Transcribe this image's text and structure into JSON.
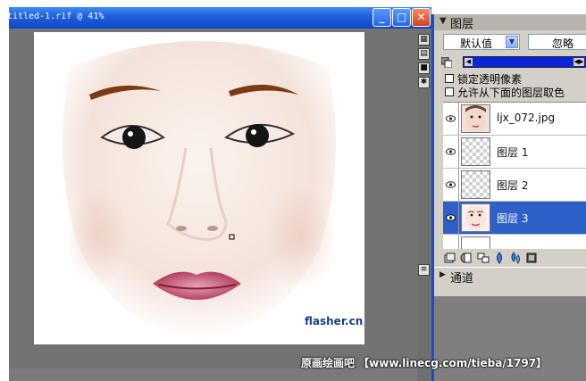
{
  "document": {
    "title": "titled-1.rif @ 41%",
    "buttons": {
      "minimize": "_",
      "maximize": "□",
      "close": "✕"
    },
    "canvas_signature": "flasher.cn"
  },
  "layers_panel": {
    "title": "图层",
    "blend_mode": "默认值",
    "opacity_label": "忽略",
    "checkboxes": [
      {
        "label": "锁定透明像素",
        "checked": false
      },
      {
        "label": "允许从下面的图层取色",
        "checked": false
      }
    ],
    "layers": [
      {
        "name": "ljx_072.jpg",
        "visible": true,
        "selected": false,
        "thumb": "face"
      },
      {
        "name": "图层 1",
        "visible": true,
        "selected": false,
        "thumb": "transparent"
      },
      {
        "name": "图层 2",
        "visible": true,
        "selected": false,
        "thumb": "transparent"
      },
      {
        "name": "图层 3",
        "visible": true,
        "selected": true,
        "thumb": "face-light"
      }
    ],
    "channels_title": "通道"
  },
  "watermark": "原画绘画吧 【www.linecg.com/tieba/1797】",
  "colors": {
    "accent": "#1b4dd1",
    "selection": "#2d60c8",
    "titlebar": "#1f5fdb"
  }
}
